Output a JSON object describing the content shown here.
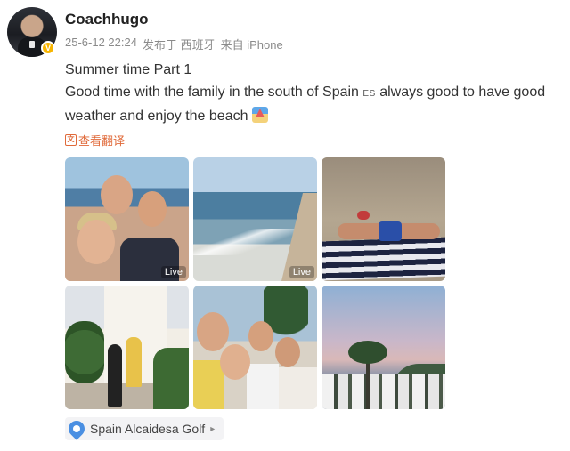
{
  "user": {
    "name": "Coachhugo",
    "verified_badge": "V"
  },
  "meta": {
    "timestamp": "25-6-12 22:24",
    "posted_in": "发布于 西班牙",
    "source": "来自 iPhone"
  },
  "post": {
    "title": "Summer time Part 1",
    "body_part1": "Good time with the family in the south of Spain",
    "flag_code": "ES",
    "body_part2": " always good to have good weather and enjoy the beach",
    "emoji": "beach-umbrella-emoji"
  },
  "translate": {
    "label": "查看翻译"
  },
  "photos": [
    {
      "live": "Live"
    },
    {
      "live": "Live"
    },
    {
      "live": ""
    },
    {
      "live": ""
    },
    {
      "live": ""
    },
    {
      "live": ""
    }
  ],
  "location": {
    "label": "Spain Alcaidesa Golf",
    "chevron": "▸"
  },
  "colors": {
    "accent": "#e06a3a",
    "pin": "#4a8fe2",
    "badge": "#f7b500"
  }
}
